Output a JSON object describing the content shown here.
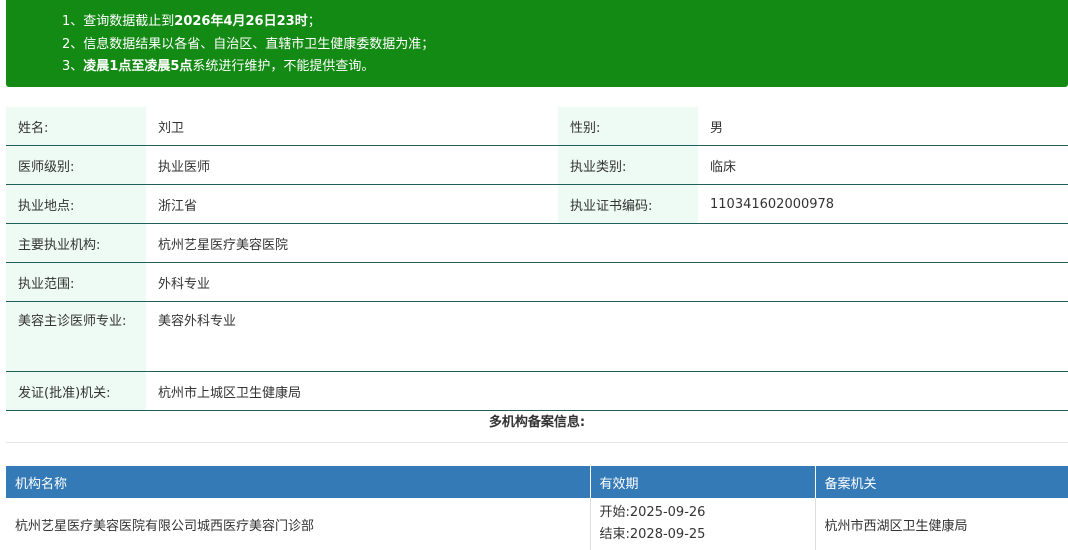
{
  "notice": {
    "line1": {
      "prefix": "1、查询数据截止到",
      "bold": "2026年4月26日23时",
      "suffix": "；"
    },
    "line2": "2、信息数据结果以各省、自治区、直辖市卫生健康委数据为准；",
    "line3": {
      "prefix": "3、",
      "bold": "凌晨1点至凌晨5点",
      "suffix": "系统进行维护，不能提供查询。"
    }
  },
  "doctor": {
    "name_label": "姓名:",
    "name": "刘卫",
    "gender_label": "性别:",
    "gender": "男",
    "level_label": "医师级别:",
    "level": "执业医师",
    "category_label": "执业类别:",
    "category": "临床",
    "location_label": "执业地点:",
    "location": "浙江省",
    "cert_label": "执业证书编码:",
    "cert_no": "110341602000978",
    "institution_label": "主要执业机构:",
    "institution": "杭州艺星医疗美容医院",
    "scope_label": "执业范围:",
    "scope": "外科专业",
    "cosmetic_label": "美容主诊医师专业:",
    "cosmetic": "美容外科专业",
    "issuer_label": "发证(批准)机关:",
    "issuer": "杭州市上城区卫生健康局"
  },
  "multi": {
    "title": "多机构备案信息:",
    "headers": {
      "name": "机构名称",
      "period": "有效期",
      "authority": "备案机关"
    },
    "rows": [
      {
        "name": "杭州艺星医疗美容医院有限公司城西医疗美容门诊部",
        "start_label": "开始:",
        "start": "2025-09-26",
        "end_label": "结束:",
        "end": "2028-09-25",
        "authority": "杭州市西湖区卫生健康局"
      }
    ]
  },
  "colors": {
    "notice_bg": "#138a13",
    "label_bg": "#eefaf4",
    "row_border": "#1f5f5a",
    "table_header_bg": "#337ab7"
  }
}
